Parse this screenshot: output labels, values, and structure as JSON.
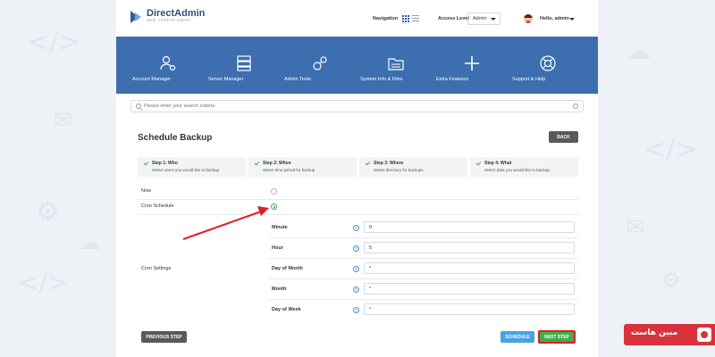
{
  "brand": {
    "name": "DirectAdmin",
    "tagline": "web control panel"
  },
  "header": {
    "navigation_label": "Navigation",
    "access_level_label": "Access Level",
    "access_level_value": "Admin",
    "user_greeting": "Hello, admin"
  },
  "menu": [
    {
      "label": "Account Manager",
      "icon": "users-gear-icon"
    },
    {
      "label": "Server Manager",
      "icon": "server-icon"
    },
    {
      "label": "Admin Tools",
      "icon": "tools-icon"
    },
    {
      "label": "System Info & Files",
      "icon": "folder-icon"
    },
    {
      "label": "Extra Features",
      "icon": "plus-icon"
    },
    {
      "label": "Support & Help",
      "icon": "lifebuoy-icon"
    }
  ],
  "search": {
    "placeholder": "Please enter your search criteria"
  },
  "page": {
    "title": "Schedule Backup",
    "back_label": "BACK"
  },
  "steps": [
    {
      "title": "Step 1: Who",
      "desc": "Select users you would like to backup."
    },
    {
      "title": "Step 2: When",
      "desc": "Select time period for backup."
    },
    {
      "title": "Step 3: Where",
      "desc": "Select directory for backups."
    },
    {
      "title": "Step 4: What",
      "desc": "Select data you would like to backup."
    }
  ],
  "form": {
    "now_label": "Now",
    "now_selected": false,
    "cron_label": "Cron Schedule",
    "cron_selected": true,
    "cron_settings_label": "Cron Settings",
    "fields": [
      {
        "label": "Minute",
        "value": "0"
      },
      {
        "label": "Hour",
        "value": "5"
      },
      {
        "label": "Day of Month",
        "value": "*"
      },
      {
        "label": "Month",
        "value": "*"
      },
      {
        "label": "Day of Week",
        "value": "*"
      }
    ]
  },
  "buttons": {
    "previous_label": "PREVIOUS STEP",
    "schedule_label": "SCHEDULE",
    "next_label": "NEXT STEP"
  },
  "annotation": {
    "arrow_color": "#e21d24",
    "highlight_color": "#e21d24"
  },
  "watermark": {
    "text": "مبین هاست"
  },
  "colors": {
    "banner": "#3c6eb0",
    "success": "#3fae49",
    "info": "#4aa3df",
    "dark_button": "#58595b"
  }
}
